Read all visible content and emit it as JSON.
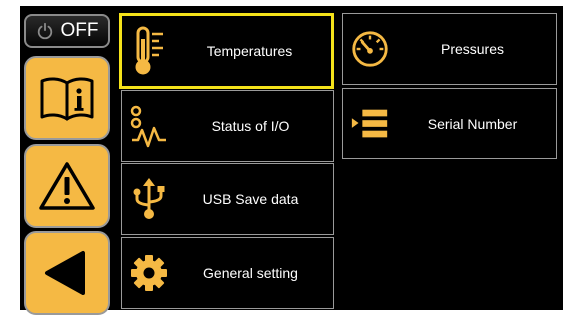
{
  "power_button": {
    "label": "OFF",
    "icon": "power-icon"
  },
  "side_buttons": [
    {
      "name": "manual",
      "icon": "manual-book-icon"
    },
    {
      "name": "alarms",
      "icon": "warning-triangle-icon"
    },
    {
      "name": "back",
      "icon": "back-arrow-icon"
    }
  ],
  "menu": {
    "temperatures": "Temperatures",
    "pressures": "Pressures",
    "status_io": "Status of I/O",
    "serial_number": "Serial Number",
    "usb_save": "USB Save data",
    "general_setting": "General setting"
  },
  "colors": {
    "accent": "#f5b944",
    "selection": "#f5e21a",
    "background": "#000000",
    "text": "#ffffff"
  },
  "selected_item": "Temperatures"
}
